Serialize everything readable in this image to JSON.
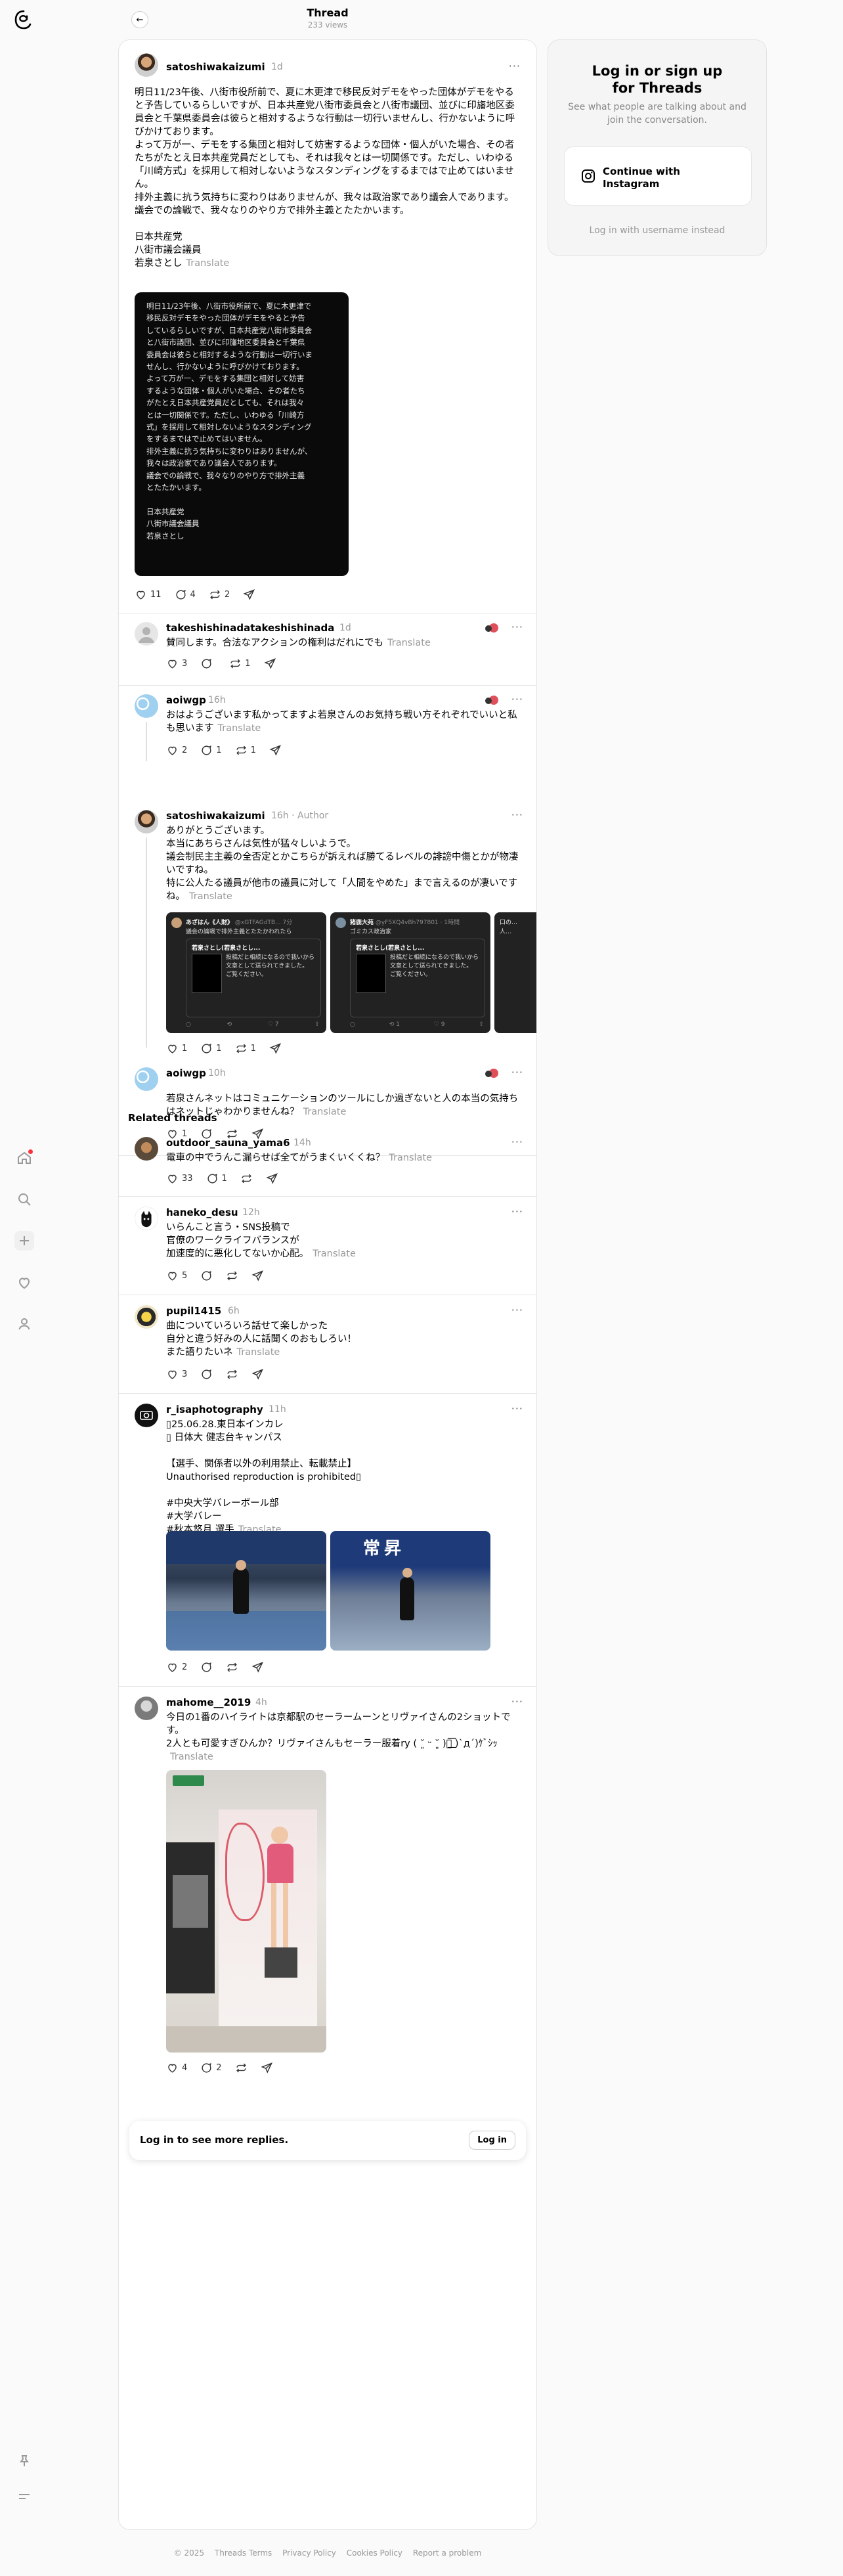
{
  "header": {
    "title": "Thread",
    "views": "233 views"
  },
  "login": {
    "title": "Log in or sign up for Threads",
    "subtitle": "See what people are talking about and join the conversation.",
    "instagram": "Continue with Instagram",
    "username": "Log in with username instead"
  },
  "translate": "Translate",
  "author_label": "Author",
  "main_post": {
    "user": "satoshiwakaizumi",
    "time": "1d",
    "text": "明日11/23午後、八街市役所前で、夏に木更津で移民反対デモをやった団体がデモをやると予告しているらしいですが、日本共産党八街市委員会と八街市議団、並びに印旛地区委員会と千葉県委員会は彼らと相対するような行動は一切行いませんし、行かないように呼びかけております。\nよって万が一、デモをする集団と相対して妨害するような団体・個人がいた場合、その者たちがたとえ日本共産党員だとしても、それは我々とは一切関係です。ただし、いわゆる「川崎方式」を採用して相対しないようなスタンディングをするまではで止めてはいません。\n排外主義に抗う気持ちに変わりはありませんが、我々は政治家であり議会人であります。\n議会での論戦で、我々なりのやり方で排外主義とたたかいます。\n\n日本共産党\n八街市議会議員\n若泉さとし",
    "image_text": "明日11/23午後、八街市役所前で、夏に木更津で\n移民反対デモをやった団体がデモをやると予告\nしているらしいですが、日本共産党八街市委員会\nと八街市議団、並びに印旛地区委員会と千葉県\n委員会は彼らと相対するような行動は一切行いま\nせんし、行かないように呼びかけております。\nよって万が一、デモをする集団と相対して妨害\nするような団体・個人がいた場合、その者たち\nがたとえ日本共産党員だとしても、それは我々\nとは一切関係です。ただし、いわゆる「川崎方\n式」を採用して相対しないようなスタンディング\nをするまではで止めてはいません。\n排外主義に抗う気持ちに変わりはありませんが、\n我々は政治家であり議会人であります。\n議会での論戦で、我々なりのやり方で排外主義\nとたたかいます。\n\n日本共産党\n八街市議会議員\n若泉さとし",
    "likes": "11",
    "replies": "4",
    "reposts": "2"
  },
  "replies": [
    {
      "user": "takeshishinadatakeshishinada",
      "time": "1d",
      "text": "賛同します。合法なアクションの権利はだれにでも",
      "likes": "3",
      "replies": "",
      "reposts": "1"
    },
    {
      "user": "aoiwgp",
      "time": "16h",
      "text": "おはようございます私かってますよ若泉さんのお気持ち戦い方それぞれでいいと私も思います",
      "likes": "2",
      "replies": "1",
      "reposts": "1"
    },
    {
      "user": "satoshiwakaizumi",
      "time": "16h",
      "text": "ありがとうございます。\n本当にあちらさんは気性が猛々しいようで。\n議会制民主主義の全否定とかこちらが訴えれば勝てるレベルの誹謗中傷とかが物凄いですね。\n特に公人たる議員が他市の議員に対して「人間をやめた」まで言えるのが凄いですね。",
      "likes": "1",
      "replies": "1",
      "reposts": "1",
      "screenshots": [
        {
          "user": "あざはん《人財》",
          "handle": "@xGTFAGdTB... 7分",
          "caption": "議会の論戦で排外主義とたたかわれたら",
          "quote": "若泉さとし(若泉さとし...",
          "body": "投稿だと相続になるので我いから文章として送られてきました。\nご覧ください。",
          "stats": [
            "",
            "",
            "7",
            ""
          ]
        },
        {
          "user": "猪鹿大苑",
          "handle": "@yF5XQ4vBh797801 · 1時間",
          "caption": "ゴミカス政治家",
          "quote": "若泉さとし(若泉さとし...",
          "body": "投稿だと相続になるので我いから文章として送られてきました。\nご覧ください。",
          "stats": [
            "",
            "1",
            "9",
            ""
          ]
        },
        {
          "user": "口の…",
          "handle": "",
          "caption": "人…",
          "quote": "",
          "body": "",
          "stats": []
        }
      ]
    },
    {
      "user": "aoiwgp",
      "time": "10h",
      "text": "若泉さんネットはコミュニケーションのツールにしか過ぎないと人の本当の気持ちはネットじゃわかりませんね？",
      "likes": "1",
      "replies": "",
      "reposts": ""
    }
  ],
  "related_title": "Related threads",
  "related": [
    {
      "user": "outdoor_sauna_yama6",
      "time": "14h",
      "text": "電車の中でうんこ漏らせば全てがうまくいくくね？",
      "likes": "33",
      "replies": "1",
      "reposts": ""
    },
    {
      "user": "haneko_desu",
      "time": "12h",
      "text": "いらんこと言う・SNS投稿で\n官僚のワークライフバランスが\n加速度的に悪化してないか心配。",
      "likes": "5",
      "replies": "",
      "reposts": ""
    },
    {
      "user": "pupil1415",
      "time": "6h",
      "text": "曲についていろいろ話せて楽しかった\n自分と違う好みの人に話聞くのおもしろい！\nまた語りたいネ",
      "likes": "3",
      "replies": "",
      "reposts": ""
    },
    {
      "user": "r_isaphotography",
      "time": "11h",
      "text": "▯25.06.28.東日本インカレ\n▯ 日体大 健志台キャンパス\n\n【選手、関係者以外の利用禁止、転載禁止】\nUnauthorised reproduction is prohibited▯\n\n#中央大学バレーボール部\n#大学バレー\n#秋本悠月 選手",
      "photo_banner": "常昇",
      "likes": "2",
      "replies": "",
      "reposts": ""
    },
    {
      "user": "mahome__2019",
      "time": "4h",
      "text": "今日の1番のハイライトは京都駅のセーラームーンとリヴァイさんの2ショットです。\n2人とも可愛すぎひんか？リヴァイさんもセーラー服着ry ( ˘͈ ᵕ ˘͈ )ｰ͟͟͞͞ )`д´)ｹﾞｼｯ",
      "likes": "4",
      "replies": "2",
      "reposts": ""
    }
  ],
  "login_more": {
    "text": "Log in to see more replies.",
    "button": "Log in"
  },
  "footer": [
    "© 2025",
    "Threads Terms",
    "Privacy Policy",
    "Cookies Policy",
    "Report a problem"
  ],
  "colors": {
    "accent": "#ff3040",
    "muted": "#999999",
    "border": "#e5e5e5"
  }
}
